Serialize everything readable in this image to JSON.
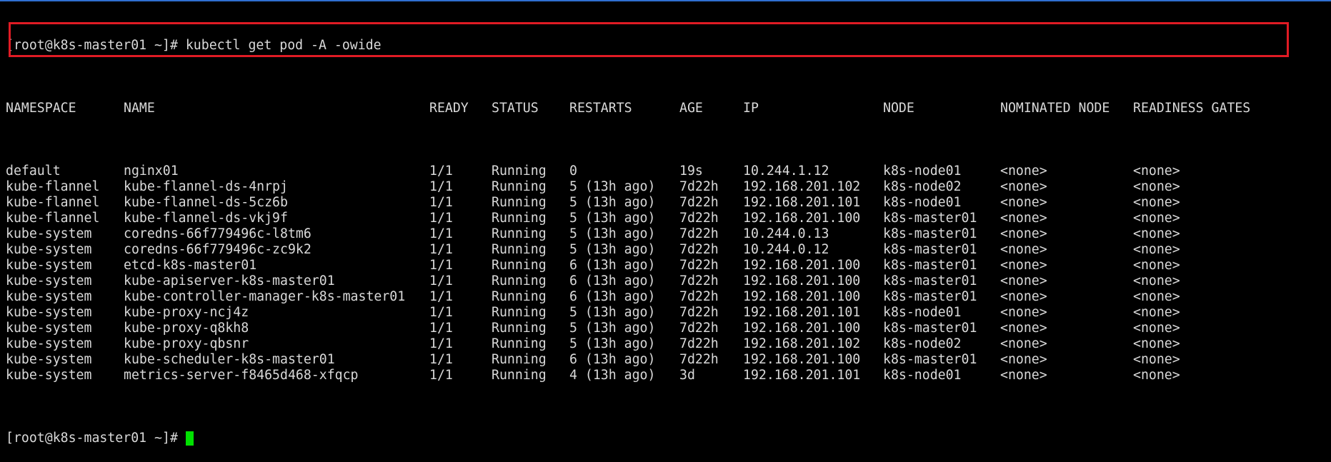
{
  "terminal": {
    "command_prompt": "[root@k8s-master01 ~]# kubectl get pod -A -owide",
    "final_prompt": "[root@k8s-master01 ~]#",
    "headers": {
      "namespace": "NAMESPACE",
      "name": "NAME",
      "ready": "READY",
      "status": "STATUS",
      "restarts": "RESTARTS",
      "age": "AGE",
      "ip": "IP",
      "node": "NODE",
      "nominated": "NOMINATED NODE",
      "gates": "READINESS GATES"
    },
    "rows": [
      {
        "namespace": "default",
        "name": "nginx01",
        "ready": "1/1",
        "status": "Running",
        "restarts": "0",
        "age": "19s",
        "ip": "10.244.1.12",
        "node": "k8s-node01",
        "nominated": "<none>",
        "gates": "<none>"
      },
      {
        "namespace": "kube-flannel",
        "name": "kube-flannel-ds-4nrpj",
        "ready": "1/1",
        "status": "Running",
        "restarts": "5 (13h ago)",
        "age": "7d22h",
        "ip": "192.168.201.102",
        "node": "k8s-node02",
        "nominated": "<none>",
        "gates": "<none>"
      },
      {
        "namespace": "kube-flannel",
        "name": "kube-flannel-ds-5cz6b",
        "ready": "1/1",
        "status": "Running",
        "restarts": "5 (13h ago)",
        "age": "7d22h",
        "ip": "192.168.201.101",
        "node": "k8s-node01",
        "nominated": "<none>",
        "gates": "<none>"
      },
      {
        "namespace": "kube-flannel",
        "name": "kube-flannel-ds-vkj9f",
        "ready": "1/1",
        "status": "Running",
        "restarts": "5 (13h ago)",
        "age": "7d22h",
        "ip": "192.168.201.100",
        "node": "k8s-master01",
        "nominated": "<none>",
        "gates": "<none>"
      },
      {
        "namespace": "kube-system",
        "name": "coredns-66f779496c-l8tm6",
        "ready": "1/1",
        "status": "Running",
        "restarts": "5 (13h ago)",
        "age": "7d22h",
        "ip": "10.244.0.13",
        "node": "k8s-master01",
        "nominated": "<none>",
        "gates": "<none>"
      },
      {
        "namespace": "kube-system",
        "name": "coredns-66f779496c-zc9k2",
        "ready": "1/1",
        "status": "Running",
        "restarts": "5 (13h ago)",
        "age": "7d22h",
        "ip": "10.244.0.12",
        "node": "k8s-master01",
        "nominated": "<none>",
        "gates": "<none>"
      },
      {
        "namespace": "kube-system",
        "name": "etcd-k8s-master01",
        "ready": "1/1",
        "status": "Running",
        "restarts": "6 (13h ago)",
        "age": "7d22h",
        "ip": "192.168.201.100",
        "node": "k8s-master01",
        "nominated": "<none>",
        "gates": "<none>"
      },
      {
        "namespace": "kube-system",
        "name": "kube-apiserver-k8s-master01",
        "ready": "1/1",
        "status": "Running",
        "restarts": "6 (13h ago)",
        "age": "7d22h",
        "ip": "192.168.201.100",
        "node": "k8s-master01",
        "nominated": "<none>",
        "gates": "<none>"
      },
      {
        "namespace": "kube-system",
        "name": "kube-controller-manager-k8s-master01",
        "ready": "1/1",
        "status": "Running",
        "restarts": "6 (13h ago)",
        "age": "7d22h",
        "ip": "192.168.201.100",
        "node": "k8s-master01",
        "nominated": "<none>",
        "gates": "<none>"
      },
      {
        "namespace": "kube-system",
        "name": "kube-proxy-ncj4z",
        "ready": "1/1",
        "status": "Running",
        "restarts": "5 (13h ago)",
        "age": "7d22h",
        "ip": "192.168.201.101",
        "node": "k8s-node01",
        "nominated": "<none>",
        "gates": "<none>"
      },
      {
        "namespace": "kube-system",
        "name": "kube-proxy-q8kh8",
        "ready": "1/1",
        "status": "Running",
        "restarts": "5 (13h ago)",
        "age": "7d22h",
        "ip": "192.168.201.100",
        "node": "k8s-master01",
        "nominated": "<none>",
        "gates": "<none>"
      },
      {
        "namespace": "kube-system",
        "name": "kube-proxy-qbsnr",
        "ready": "1/1",
        "status": "Running",
        "restarts": "5 (13h ago)",
        "age": "7d22h",
        "ip": "192.168.201.102",
        "node": "k8s-node02",
        "nominated": "<none>",
        "gates": "<none>"
      },
      {
        "namespace": "kube-system",
        "name": "kube-scheduler-k8s-master01",
        "ready": "1/1",
        "status": "Running",
        "restarts": "6 (13h ago)",
        "age": "7d22h",
        "ip": "192.168.201.100",
        "node": "k8s-master01",
        "nominated": "<none>",
        "gates": "<none>"
      },
      {
        "namespace": "kube-system",
        "name": "metrics-server-f8465d468-xfqcp",
        "ready": "1/1",
        "status": "Running",
        "restarts": "4 (13h ago)",
        "age": "3d",
        "ip": "192.168.201.101",
        "node": "k8s-node01",
        "nominated": "<none>",
        "gates": "<none>"
      }
    ]
  },
  "colors": {
    "background": "#000000",
    "text": "#d9d9d9",
    "cursor": "#00e000",
    "highlight_box": "#e01b24",
    "window_border": "#2f6fd1"
  }
}
